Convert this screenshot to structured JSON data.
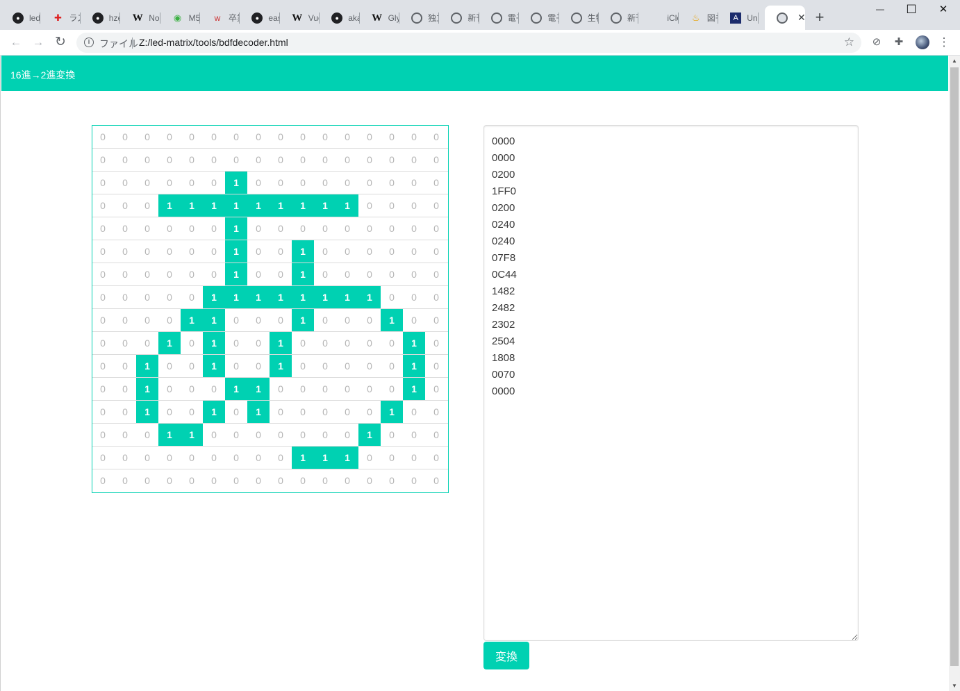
{
  "browser": {
    "tabs": [
      {
        "icon": "github-icon",
        "title": "led"
      },
      {
        "icon": "cross-icon",
        "title": "ラズ"
      },
      {
        "icon": "github-icon",
        "title": "hze"
      },
      {
        "icon": "wikipedia-icon",
        "title": "No"
      },
      {
        "icon": "green-circle-icon",
        "title": "M5"
      },
      {
        "icon": "weblio-icon",
        "title": "卒業"
      },
      {
        "icon": "github-icon",
        "title": "eas"
      },
      {
        "icon": "wikipedia-icon",
        "title": "Vue"
      },
      {
        "icon": "github-icon",
        "title": "aka"
      },
      {
        "icon": "wikipedia-icon",
        "title": "Gly"
      },
      {
        "icon": "globe-icon",
        "title": "独立"
      },
      {
        "icon": "globe-icon",
        "title": "新刊"
      },
      {
        "icon": "globe-icon",
        "title": "電子"
      },
      {
        "icon": "globe-icon",
        "title": "電子"
      },
      {
        "icon": "globe-icon",
        "title": "生物"
      },
      {
        "icon": "globe-icon",
        "title": "新刊"
      },
      {
        "icon": "apple-icon",
        "title": "iClo"
      },
      {
        "icon": "jar-icon",
        "title": "図书"
      },
      {
        "icon": "unicode-icon",
        "title": "Uni"
      }
    ],
    "active_tab": {
      "icon": "globe-icon",
      "close": "✕"
    },
    "new_tab": "+",
    "window_controls": {
      "minimize": "—",
      "maximize": "☐",
      "close": "✕"
    },
    "omnibox": {
      "scheme": "ファイル",
      "url": "Z:/led-matrix/tools/bdfdecoder.html",
      "info": "i",
      "star": "☆"
    },
    "nav": {
      "back": "←",
      "forward": "→",
      "reload": "↻"
    },
    "toolbar_icons": {
      "extension1": "⊘",
      "extensions": "✚",
      "menu": "⋮"
    }
  },
  "page": {
    "brand": "16進→2進変換",
    "hex_values": "0000\n0000\n0200\n1FF0\n0200\n0240\n0240\n07F8\n0C44\n1482\n2482\n2302\n2504\n1808\n0070\n0000",
    "convert_label": "変換",
    "matrix": [
      "0000000000000000",
      "0000000000000000",
      "0000001000000000",
      "0001111111110000",
      "0000001000000000",
      "0000001001000000",
      "0000001001000000",
      "0000011111111000",
      "0000110001000100",
      "0001010010000010",
      "0010010010000010",
      "0010001100000010",
      "0010010100000100",
      "0001100000001000",
      "0000000001110000",
      "0000000000000000"
    ]
  },
  "colors": {
    "accent": "#00d1b2",
    "cell_off_text": "#b5b5b5",
    "border": "#dbdbdb"
  }
}
